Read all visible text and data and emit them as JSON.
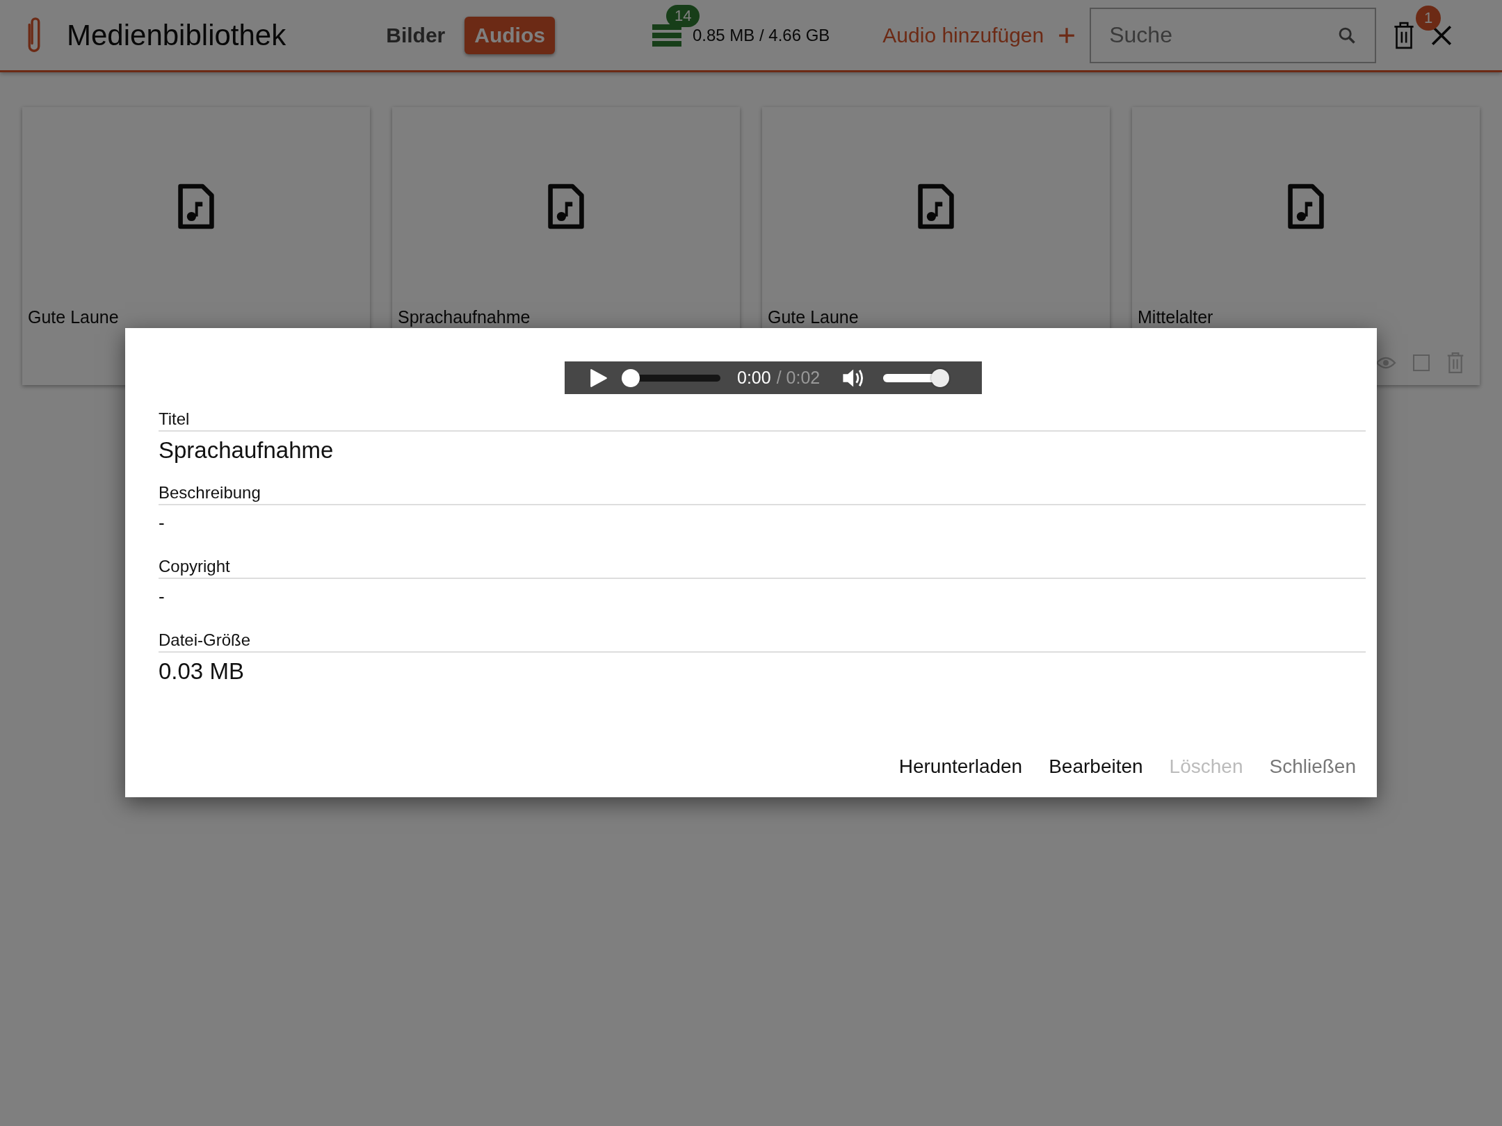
{
  "header": {
    "title": "Medienbibliothek",
    "tabs": [
      {
        "label": "Bilder",
        "selected": false
      },
      {
        "label": "Audios",
        "selected": true
      }
    ],
    "storage": {
      "count": "14",
      "usage": "0.85 MB / 4.66 GB"
    },
    "add_label": "Audio hinzufügen",
    "search": {
      "placeholder": "Suche"
    },
    "trash_count": "1"
  },
  "cards": [
    {
      "title": "Gute Laune"
    },
    {
      "title": "Sprachaufnahme"
    },
    {
      "title": "Gute Laune"
    },
    {
      "title": "Mittelalter",
      "actions": {
        "checked": false
      }
    }
  ],
  "dialog": {
    "player": {
      "current": "0:00",
      "duration": "/ 0:02",
      "level": 0,
      "volume": {
        "level": 1
      }
    },
    "fields": [
      {
        "label": "Titel",
        "value": "Sprachaufnahme"
      },
      {
        "label": "Beschreibung",
        "value": "-"
      },
      {
        "label": "Copyright",
        "value": "-"
      },
      {
        "label": "Datei-Größe",
        "value": "0.03 MB"
      }
    ],
    "buttons": [
      {
        "label": "Herunterladen",
        "kind": "action",
        "disabled": false
      },
      {
        "label": "Bearbeiten",
        "kind": "action",
        "disabled": false
      },
      {
        "label": "Löschen",
        "kind": "action",
        "disabled": true
      },
      {
        "label": "Schließen",
        "kind": "close",
        "disabled": false
      }
    ]
  }
}
